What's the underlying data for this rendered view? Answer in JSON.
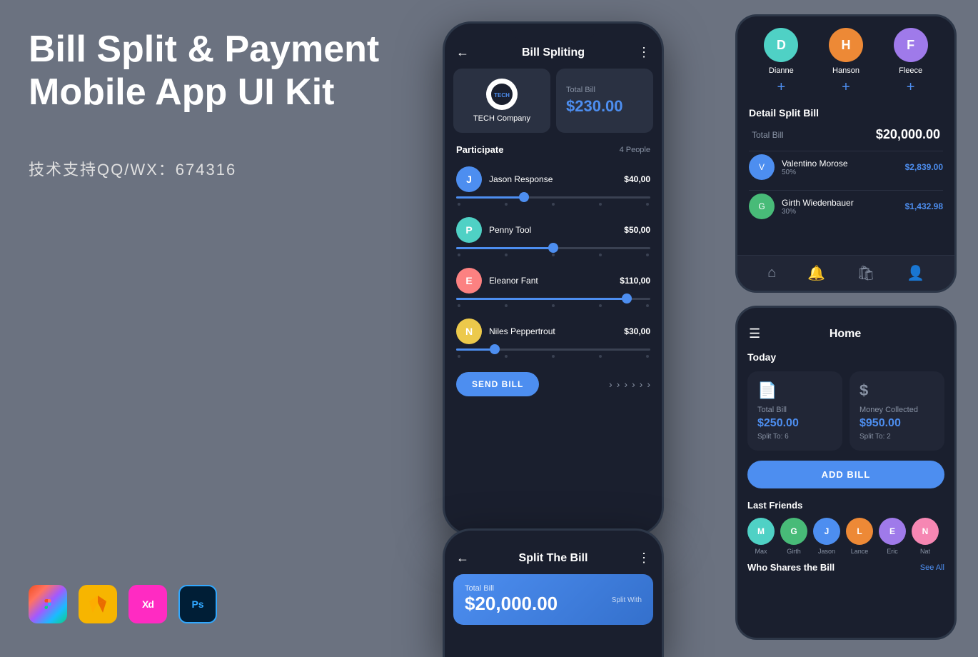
{
  "page": {
    "background": "#6b7280"
  },
  "hero": {
    "title_line1": "Bill Split & Payment",
    "title_line2": "Mobile App UI Kit",
    "subtitle": "技术支持QQ/WX：674316"
  },
  "tools": [
    {
      "name": "Figma",
      "label": "F"
    },
    {
      "name": "Sketch",
      "label": "S"
    },
    {
      "name": "XD",
      "label": "Xd"
    },
    {
      "name": "Photoshop",
      "label": "Ps"
    }
  ],
  "phone1": {
    "header_title": "Bill Spliting",
    "company_name": "TECH Company",
    "total_bill_label": "Total Bill",
    "total_bill_amount": "$230.00",
    "participate_label": "Participate",
    "people_count": "4 People",
    "persons": [
      {
        "name": "Jason Response",
        "amount": "$40,00",
        "slider_pct": 35
      },
      {
        "name": "Penny Tool",
        "amount": "$50,00",
        "slider_pct": 50
      },
      {
        "name": "Eleanor Fant",
        "amount": "$110,00",
        "slider_pct": 88
      },
      {
        "name": "Niles Peppertrout",
        "amount": "$30,00",
        "slider_pct": 20
      }
    ],
    "send_button": "SEND BILL"
  },
  "phone2": {
    "header_title": "Split The Bill",
    "total_bill_label": "Total Bill",
    "total_bill_amount": "$20,000.00",
    "split_with_label": "Split With"
  },
  "right_top": {
    "friends": [
      {
        "name": "Dianne"
      },
      {
        "name": "Hanson"
      },
      {
        "name": "Fleece"
      }
    ],
    "detail_title": "Detail Split Bill",
    "total_bill_label": "Total Bill",
    "total_bill_value": "$20,000.00",
    "splits": [
      {
        "name": "Valentino Morose",
        "pct": "50%",
        "amount": "$2,839.00"
      },
      {
        "name": "Girth Wiedenbauer",
        "pct": "30%",
        "amount": "$1,432.98"
      }
    ]
  },
  "right_bottom": {
    "header_title": "Home",
    "today_label": "Today",
    "cards": [
      {
        "icon": "📄",
        "title": "Total Bill",
        "amount": "$250.00",
        "sub": "Split To: 6"
      },
      {
        "icon": "$",
        "title": "Money Collected",
        "amount": "$950.00",
        "sub": "Split To: 2"
      }
    ],
    "add_bill_button": "ADD BILL",
    "last_friends_label": "Last Friends",
    "friends": [
      {
        "name": "Max"
      },
      {
        "name": "Girth"
      },
      {
        "name": "Jason"
      },
      {
        "name": "Lance"
      },
      {
        "name": "Eric"
      },
      {
        "name": "Nat"
      }
    ],
    "who_shares_label": "Who Shares the Bill",
    "see_all_label": "See All"
  }
}
